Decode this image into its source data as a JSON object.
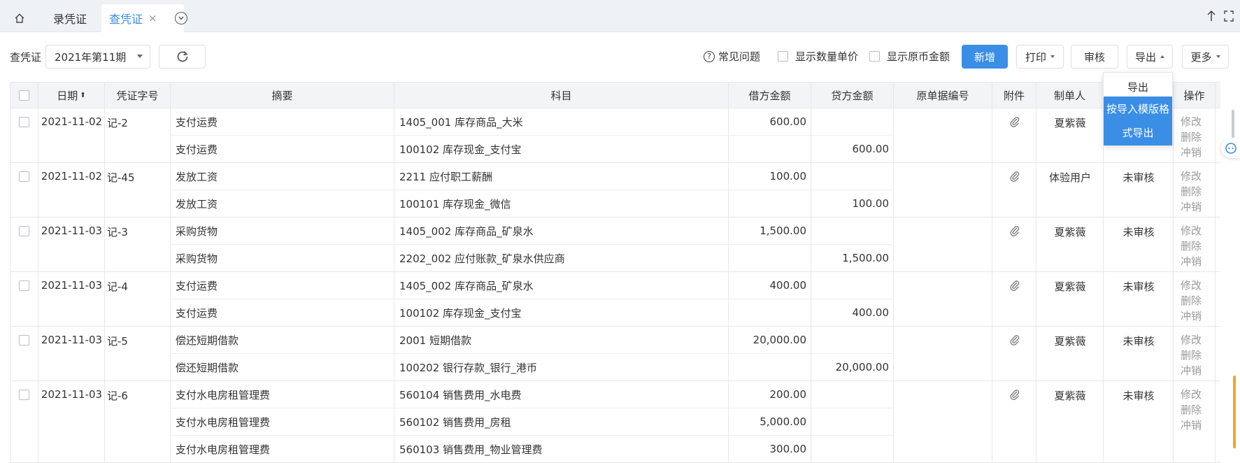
{
  "tabs": {
    "home_icon": "home-icon",
    "items": [
      {
        "label": "录凭证"
      },
      {
        "label": "查凭证",
        "close": "×"
      }
    ]
  },
  "toolbar": {
    "label": "查凭证",
    "period": "2021年第11期",
    "faq": "常见问题",
    "show_qty": "显示数量单价",
    "show_fc": "显示原币金额",
    "new": "新增",
    "print": "打印",
    "audit": "审核",
    "export": "导出",
    "more": "更多"
  },
  "export_menu": {
    "export": "导出",
    "template_line1": "按导入模版格",
    "template_line2": "式导出"
  },
  "columns": {
    "date": "日期",
    "sort_arrow": "⬆",
    "voucher_no": "凭证字号",
    "summary": "摘要",
    "account": "科目",
    "debit": "借方金额",
    "credit": "贷方金额",
    "orig_doc": "原单据编号",
    "attachment": "附件",
    "creator": "制单人",
    "auditor": "",
    "ops": "操作"
  },
  "vouchers": [
    {
      "date": "2021-11-02",
      "no": "记-2",
      "creator": "夏紫薇",
      "status": "",
      "lines": [
        {
          "summary": "支付运费",
          "account": "1405_001 库存商品_大米",
          "debit": "600.00",
          "credit": ""
        },
        {
          "summary": "支付运费",
          "account": "100102 库存现金_支付宝",
          "debit": "",
          "credit": "600.00"
        }
      ]
    },
    {
      "date": "2021-11-02",
      "no": "记-45",
      "creator": "体验用户",
      "status": "未审核",
      "lines": [
        {
          "summary": "发放工资",
          "account": "2211 应付职工薪酬",
          "debit": "100.00",
          "credit": ""
        },
        {
          "summary": "发放工资",
          "account": "100101 库存现金_微信",
          "debit": "",
          "credit": "100.00"
        }
      ]
    },
    {
      "date": "2021-11-03",
      "no": "记-3",
      "creator": "夏紫薇",
      "status": "未审核",
      "lines": [
        {
          "summary": "采购货物",
          "account": "1405_002 库存商品_矿泉水",
          "debit": "1,500.00",
          "credit": ""
        },
        {
          "summary": "采购货物",
          "account": "2202_002 应付账款_矿泉水供应商",
          "debit": "",
          "credit": "1,500.00"
        }
      ]
    },
    {
      "date": "2021-11-03",
      "no": "记-4",
      "creator": "夏紫薇",
      "status": "未审核",
      "lines": [
        {
          "summary": "支付运费",
          "account": "1405_002 库存商品_矿泉水",
          "debit": "400.00",
          "credit": ""
        },
        {
          "summary": "支付运费",
          "account": "100102 库存现金_支付宝",
          "debit": "",
          "credit": "400.00"
        }
      ]
    },
    {
      "date": "2021-11-03",
      "no": "记-5",
      "creator": "夏紫薇",
      "status": "未审核",
      "lines": [
        {
          "summary": "偿还短期借款",
          "account": "2001 短期借款",
          "debit": "20,000.00",
          "credit": ""
        },
        {
          "summary": "偿还短期借款",
          "account": "100202 银行存款_银行_港币",
          "debit": "",
          "credit": "20,000.00"
        }
      ]
    },
    {
      "date": "2021-11-03",
      "no": "记-6",
      "creator": "夏紫薇",
      "status": "未审核",
      "lines": [
        {
          "summary": "支付水电房租管理费",
          "account": "560104 销售费用_水电费",
          "debit": "200.00",
          "credit": ""
        },
        {
          "summary": "支付水电房租管理费",
          "account": "560102 销售费用_房租",
          "debit": "5,000.00",
          "credit": ""
        },
        {
          "summary": "支付水电房租管理费",
          "account": "560103 销售费用_物业管理费",
          "debit": "300.00",
          "credit": ""
        }
      ]
    }
  ],
  "row_ops": {
    "edit": "修改",
    "delete": "删除",
    "reverse": "冲销"
  },
  "colors": {
    "accent": "#3a8ee6",
    "scroll_highlight": "#f5a623"
  }
}
